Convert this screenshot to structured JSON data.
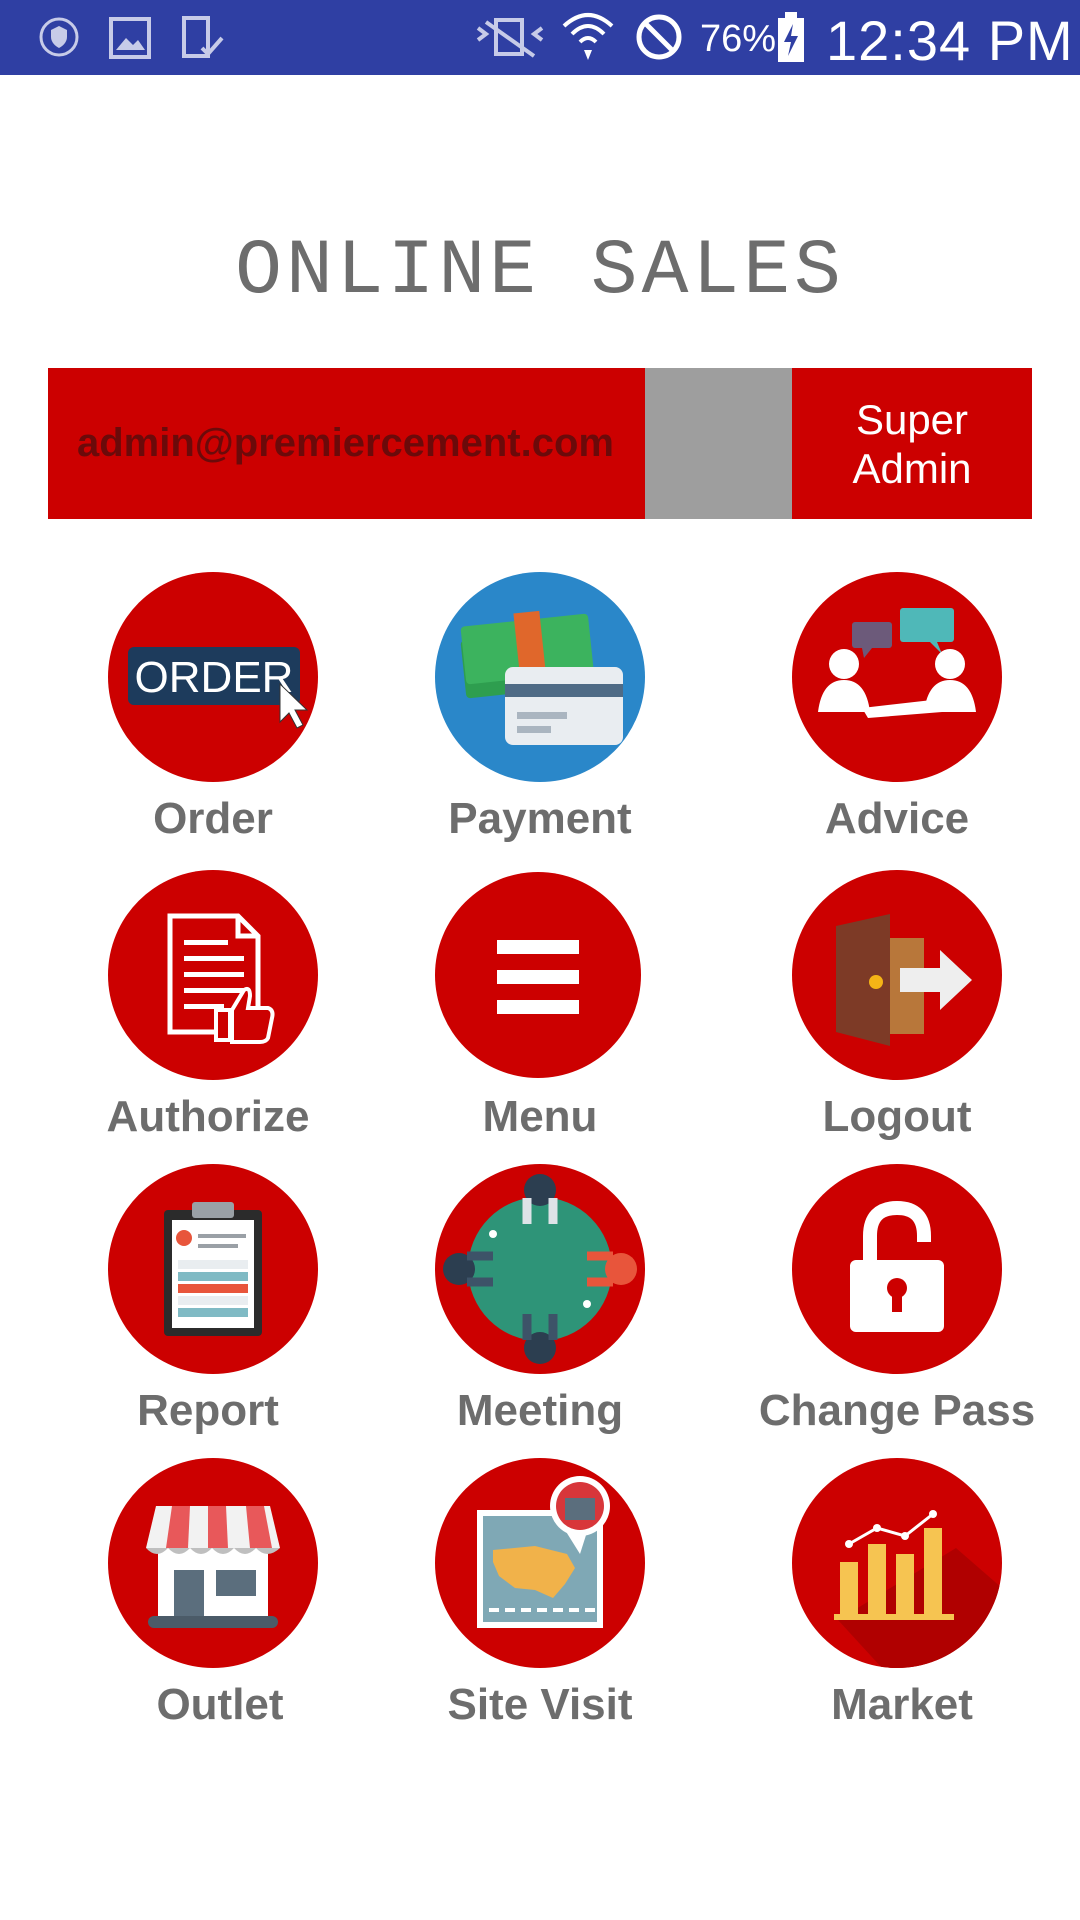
{
  "status_bar": {
    "icons": [
      "shield-icon",
      "image-icon",
      "tablet-check-icon",
      "vibrate-mute-icon",
      "wifi-icon",
      "do-not-disturb-icon",
      "battery-charging-icon"
    ],
    "battery": "76%",
    "time": "12:34 PM",
    "bar_color": "#2f3fa3"
  },
  "header": {
    "title": "ONLINE SALES"
  },
  "user": {
    "email": "admin@premiercement.com",
    "role": "Super\nAdmin",
    "accent": "#cc0000"
  },
  "tiles": [
    {
      "label": "Order",
      "icon": "order-icon",
      "icon_text": "ORDER"
    },
    {
      "label": "Payment",
      "icon": "payment-icon"
    },
    {
      "label": "Advice",
      "icon": "advice-icon"
    },
    {
      "label": "Authorize",
      "icon": "authorize-icon"
    },
    {
      "label": "Menu",
      "icon": "menu-icon"
    },
    {
      "label": "Logout",
      "icon": "logout-icon"
    },
    {
      "label": "Report",
      "icon": "report-icon"
    },
    {
      "label": "Meeting",
      "icon": "meeting-icon"
    },
    {
      "label": "Change Pass",
      "icon": "unlock-icon"
    },
    {
      "label": "Outlet",
      "icon": "outlet-icon"
    },
    {
      "label": "Site Visit",
      "icon": "site-visit-map-icon"
    },
    {
      "label": "Market",
      "icon": "market-chart-icon"
    }
  ]
}
